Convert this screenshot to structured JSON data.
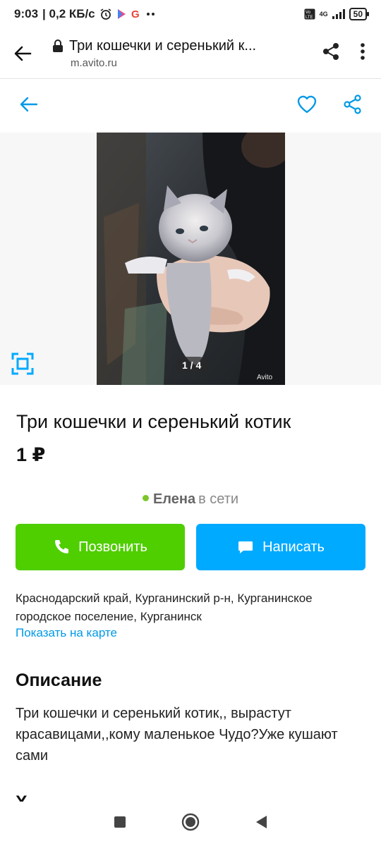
{
  "status_bar": {
    "time": "9:03",
    "speed": "| 0,2 КБ/с",
    "network": "4G",
    "battery": "50",
    "icons": [
      "alarm-icon",
      "play-store-icon",
      "google-icon",
      "more-dots-icon",
      "volte-icon",
      "signal-icon"
    ]
  },
  "browser": {
    "title": "Три кошечки и серенький к...",
    "url": "m.avito.ru"
  },
  "gallery": {
    "counter": "1 / 4",
    "watermark": "Avito"
  },
  "listing": {
    "title": "Три кошечки и серенький котик",
    "price": "1 ₽",
    "seller_name": "Елена",
    "seller_status": "в сети",
    "call_label": "Позвонить",
    "message_label": "Написать",
    "address": "Краснодарский край, Курганинский р-н, Курганинское городское поселение, Курганинск",
    "map_link": "Показать на карте",
    "description_heading": "Описание",
    "description": "Три кошечки и серенький котик,, вырастут красавицами,,кому маленькое Чудо?Уже кушают сами",
    "next_heading_partial": "Х"
  },
  "colors": {
    "call": "#4fce00",
    "message": "#00aaff",
    "accent": "#0099e6",
    "online_dot": "#7cc62b"
  }
}
